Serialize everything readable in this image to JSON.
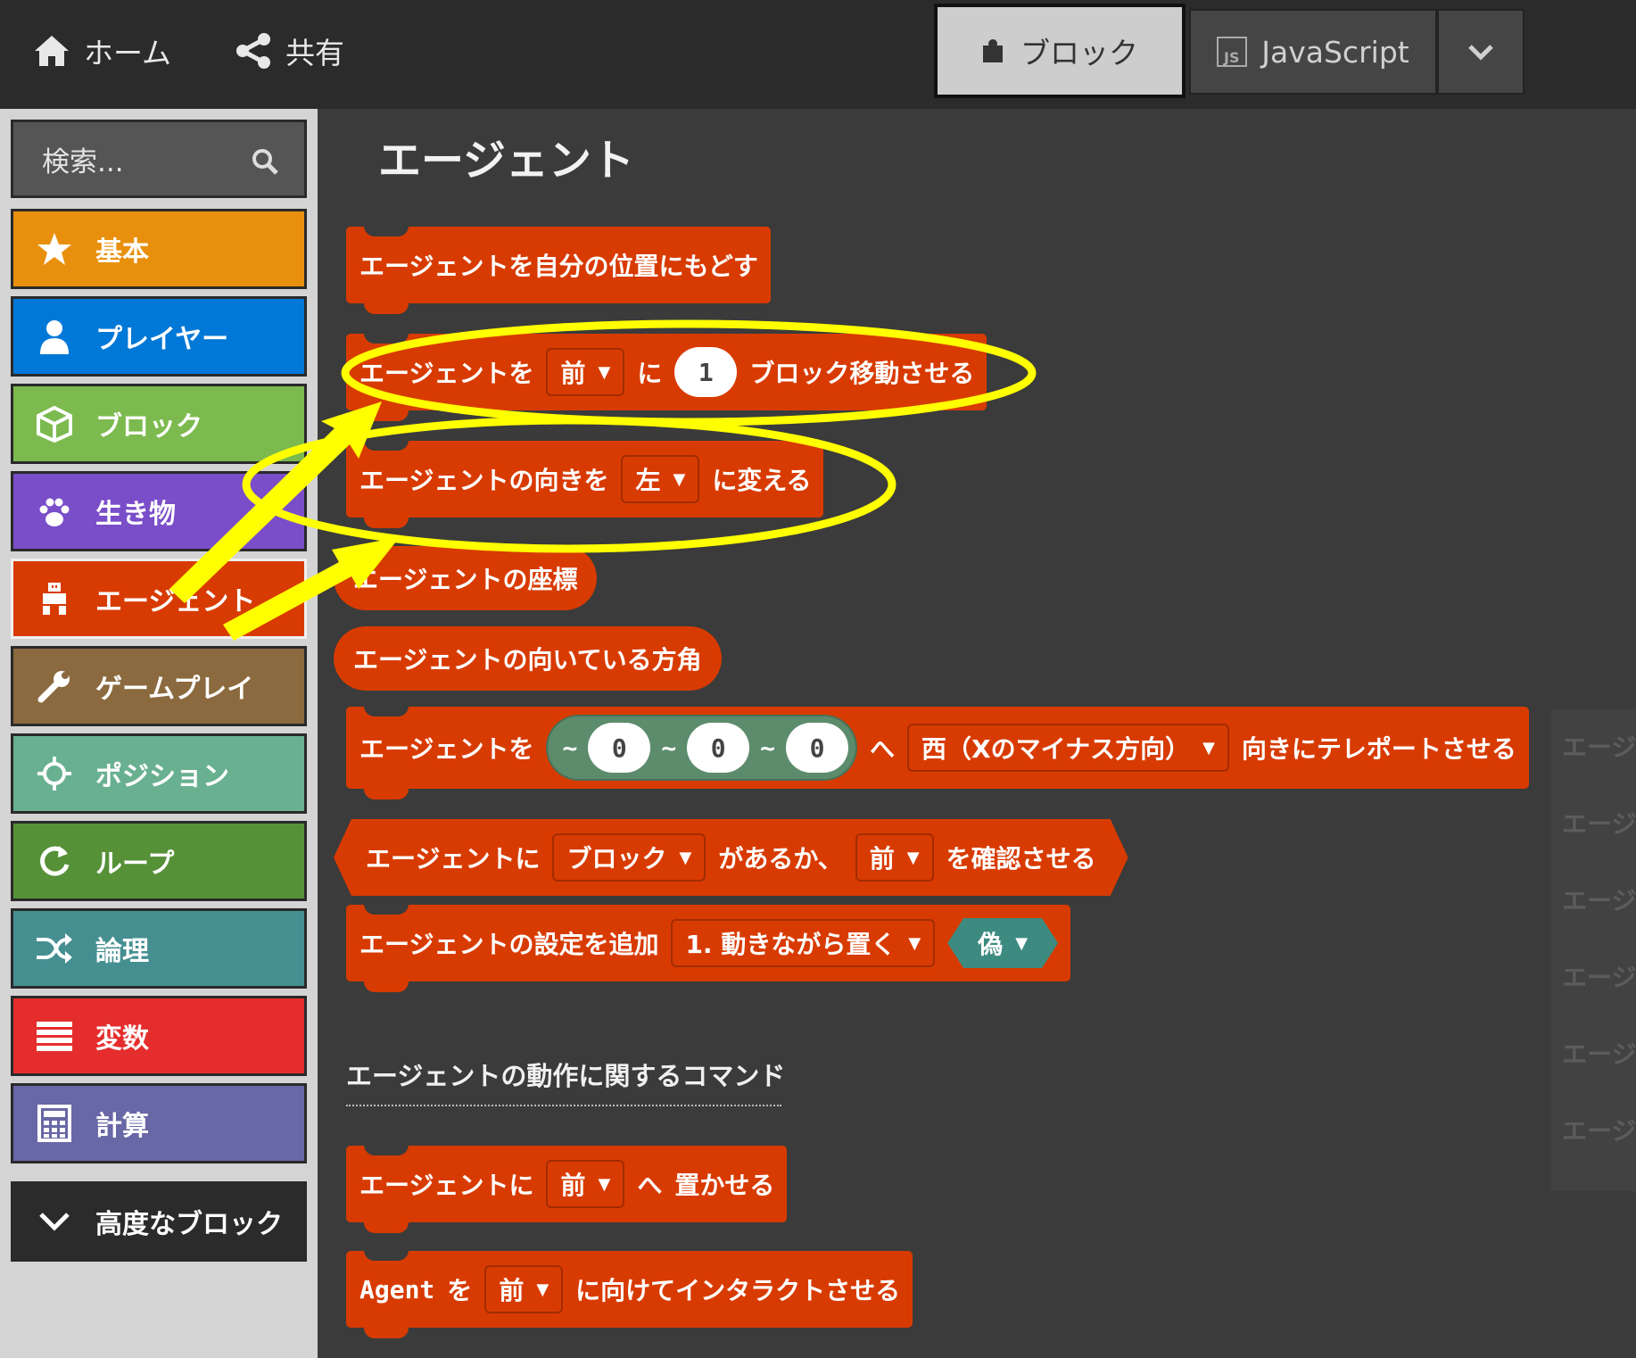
{
  "topbar": {
    "home_label": "ホーム",
    "share_label": "共有",
    "blocks_label": "ブロック",
    "js_label": "JavaScript"
  },
  "sidebar": {
    "search_placeholder": "検索...",
    "categories": [
      {
        "label": "基本",
        "color": "#e8900e",
        "icon": "star-icon"
      },
      {
        "label": "プレイヤー",
        "color": "#0078d7",
        "icon": "person-icon"
      },
      {
        "label": "ブロック",
        "color": "#7cba4f",
        "icon": "cube-icon"
      },
      {
        "label": "生き物",
        "color": "#7a4dc9",
        "icon": "paw-icon"
      },
      {
        "label": "エージェント",
        "color": "#d83b01",
        "icon": "agent-icon"
      },
      {
        "label": "ゲームプレイ",
        "color": "#8b6a3f",
        "icon": "wrench-icon"
      },
      {
        "label": "ポジション",
        "color": "#69b090",
        "icon": "crosshair-icon"
      },
      {
        "label": "ループ",
        "color": "#569138",
        "icon": "loop-icon"
      },
      {
        "label": "論理",
        "color": "#458f91",
        "icon": "shuffle-icon"
      },
      {
        "label": "変数",
        "color": "#e52d2d",
        "icon": "list-icon"
      },
      {
        "label": "計算",
        "color": "#6868a6",
        "icon": "calculator-icon"
      }
    ],
    "advanced_label": "高度なブロック"
  },
  "flyout": {
    "title": "エージェント",
    "blocks": {
      "b1": {
        "text": "エージェントを自分の位置にもどす"
      },
      "b2": {
        "t1": "エージェントを",
        "dir": "前",
        "t2": "に",
        "num": "1",
        "t3": "ブロック移動させる"
      },
      "b3": {
        "t1": "エージェントの向きを",
        "dir": "左",
        "t2": "に変える"
      },
      "b4": {
        "text": "エージェントの座標"
      },
      "b5": {
        "text": "エージェントの向いている方角"
      },
      "b6": {
        "t1": "エージェントを",
        "tilde": "~",
        "x": "0",
        "y": "0",
        "z": "0",
        "t2": "へ",
        "dir": "西（Xのマイナス方向）",
        "t3": "向きにテレポートさせる"
      },
      "b7": {
        "t1": "エージェントに",
        "kind": "ブロック",
        "t2": "があるか、",
        "dir": "前",
        "t3": "を確認させる"
      },
      "b8": {
        "t1": "エージェントの設定を追加",
        "opt": "1. 動きながら置く",
        "val": "偽"
      },
      "b9": {
        "t1": "エージェントに",
        "dir": "前",
        "t2": "へ",
        "t3": "置かせる"
      },
      "b10": {
        "t1": "Agent",
        "t2": "を",
        "dir": "前",
        "t3": "に向けてインタラクトさせる"
      }
    },
    "section_label": "エージェントの動作に関するコマンド"
  },
  "workspace": {
    "ghost_labels": [
      "エージェ",
      "エージェ",
      "エージェ",
      "エージェ",
      "エージェ",
      "エージェ"
    ]
  },
  "annotation": {
    "color": "#ffff00"
  }
}
